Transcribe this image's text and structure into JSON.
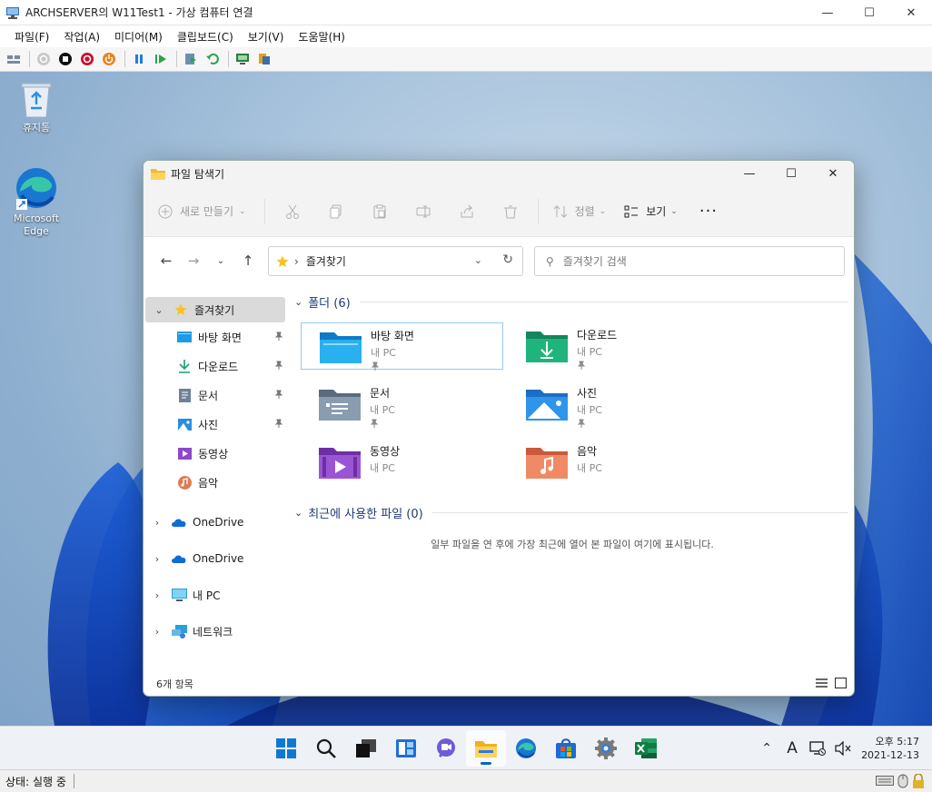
{
  "host": {
    "title": "ARCHSERVER의 W11Test1 - 가상 컴퓨터 연결",
    "menu": [
      "파일(F)",
      "작업(A)",
      "미디어(M)",
      "클립보드(C)",
      "보기(V)",
      "도움말(H)"
    ],
    "status": "상태: 실행 중"
  },
  "desktop": {
    "icons": [
      {
        "label": "휴지통",
        "icon": "recycle-bin-icon"
      },
      {
        "label": "Microsoft Edge",
        "icon": "edge-icon"
      }
    ]
  },
  "explorer": {
    "title": "파일 탐색기",
    "cmd": {
      "new_label": "새로 만들기",
      "sort_label": "정렬",
      "view_label": "보기",
      "more_label": "···"
    },
    "address": {
      "location": "즐겨찾기"
    },
    "search": {
      "placeholder": "즐겨찾기 검색"
    },
    "sidebar": {
      "quick_access": "즐겨찾기",
      "pinned": [
        {
          "label": "바탕 화면",
          "icon": "desktop-folder-icon",
          "pinned": true
        },
        {
          "label": "다운로드",
          "icon": "download-icon",
          "pinned": true
        },
        {
          "label": "문서",
          "icon": "document-icon",
          "pinned": true
        },
        {
          "label": "사진",
          "icon": "picture-icon",
          "pinned": true
        },
        {
          "label": "동영상",
          "icon": "video-icon",
          "pinned": false
        },
        {
          "label": "음악",
          "icon": "music-icon",
          "pinned": false
        }
      ],
      "roots": [
        {
          "label": "OneDrive",
          "icon": "onedrive-icon"
        },
        {
          "label": "OneDrive",
          "icon": "onedrive-icon"
        },
        {
          "label": "내 PC",
          "icon": "pc-icon"
        },
        {
          "label": "네트워크",
          "icon": "network-icon"
        }
      ]
    },
    "folders_header": "폴더 (6)",
    "folders": [
      {
        "name": "바탕 화면",
        "location": "내 PC",
        "color": "#1e9be6",
        "selected": true
      },
      {
        "name": "다운로드",
        "location": "내 PC",
        "color": "#1aa06f"
      },
      {
        "name": "문서",
        "location": "내 PC",
        "color": "#6f8196"
      },
      {
        "name": "사진",
        "location": "내 PC",
        "color": "#2a8ee0"
      },
      {
        "name": "동영상",
        "location": "내 PC",
        "color": "#8f48c9"
      },
      {
        "name": "음악",
        "location": "내 PC",
        "color": "#e07a54"
      }
    ],
    "recent_header": "최근에 사용한 파일 (0)",
    "recent_empty": "일부 파일을 연 후에 가장 최근에 열어 본 파일이 여기에 표시됩니다.",
    "status": "6개 항목"
  },
  "taskbar": {
    "apps": [
      "start-icon",
      "search-icon",
      "task-view-icon",
      "widgets-icon",
      "chat-icon",
      "file-explorer-icon",
      "edge-icon",
      "store-icon",
      "settings-icon",
      "excel-icon"
    ],
    "active_app": "file-explorer-icon",
    "ime": "A",
    "time": "오후 5:17",
    "date": "2021-12-13"
  },
  "colors": {
    "accent": "#0067c0",
    "group_header": "#1f3a78"
  }
}
